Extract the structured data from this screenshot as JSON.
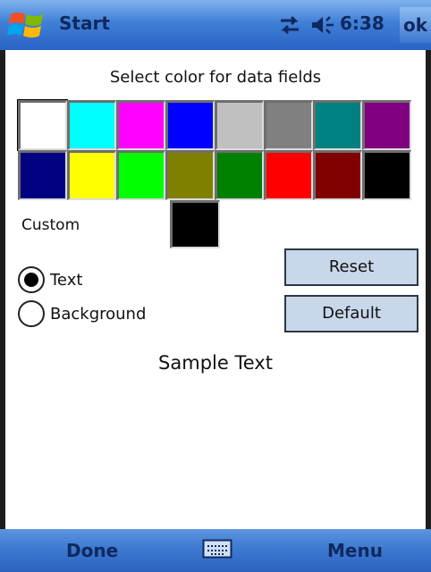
{
  "titlebar": {
    "title": "Start",
    "time": "6:38",
    "ok_label": "ok",
    "icons": [
      "windows-flag-icon",
      "connectivity-icon",
      "volume-icon"
    ]
  },
  "main": {
    "heading": "Select color for data fields",
    "palette": [
      {
        "name": "white",
        "color": "#ffffff",
        "selected": true
      },
      {
        "name": "cyan",
        "color": "#00ffff"
      },
      {
        "name": "magenta",
        "color": "#ff00ff"
      },
      {
        "name": "blue",
        "color": "#0000ff"
      },
      {
        "name": "silver",
        "color": "#c0c0c0"
      },
      {
        "name": "gray",
        "color": "#808080"
      },
      {
        "name": "teal",
        "color": "#008080"
      },
      {
        "name": "purple",
        "color": "#800080"
      },
      {
        "name": "navy",
        "color": "#000080"
      },
      {
        "name": "yellow",
        "color": "#ffff00"
      },
      {
        "name": "lime",
        "color": "#00ff00"
      },
      {
        "name": "olive",
        "color": "#808000"
      },
      {
        "name": "green",
        "color": "#008000"
      },
      {
        "name": "red",
        "color": "#ff0000"
      },
      {
        "name": "maroon",
        "color": "#800000"
      },
      {
        "name": "black",
        "color": "#000000"
      }
    ],
    "custom_label": "Custom",
    "custom_color": "#000000",
    "radio_text_label": "Text",
    "radio_background_label": "Background",
    "radio_selected": "Text",
    "reset_label": "Reset",
    "default_label": "Default",
    "sample_text": "Sample Text"
  },
  "bottombar": {
    "left_softkey": "Done",
    "right_softkey": "Menu",
    "icons": [
      "keyboard-icon"
    ]
  },
  "colors": {
    "titlebar_accent": "#3f7fd6",
    "button_fill": "#c8d7ea"
  }
}
